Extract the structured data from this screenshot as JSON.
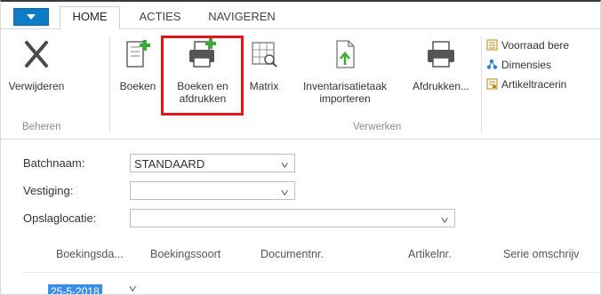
{
  "tabs": [
    {
      "label": "HOME",
      "active": true
    },
    {
      "label": "ACTIES",
      "active": false
    },
    {
      "label": "NAVIGEREN",
      "active": false
    }
  ],
  "ribbon": {
    "groups": [
      {
        "label": "Beheren"
      },
      {
        "label": "Verwerken"
      }
    ],
    "buttons": [
      {
        "label": "Verwijderen",
        "icon": "delete-x-icon"
      },
      {
        "label": "Boeken",
        "icon": "post-icon"
      },
      {
        "label": "Boeken en afdrukken",
        "icon": "post-print-icon",
        "highlighted": true
      },
      {
        "label": "Matrix",
        "icon": "matrix-icon"
      },
      {
        "label": "Inventarisatietaak importeren",
        "icon": "import-icon"
      },
      {
        "label": "Afdrukken...",
        "icon": "printer-icon"
      }
    ],
    "small_buttons": [
      {
        "label": "Voorraad bere",
        "icon": "calc-icon"
      },
      {
        "label": "Dimensies",
        "icon": "dimensions-icon"
      },
      {
        "label": "Artikeltracerin",
        "icon": "tracking-icon"
      }
    ],
    "highlight_color": "#e1131b"
  },
  "form": {
    "batch": {
      "label": "Batchnaam:",
      "value": "STANDAARD"
    },
    "location": {
      "label": "Vestiging:",
      "value": ""
    },
    "bin": {
      "label": "Opslaglocatie:",
      "value": ""
    }
  },
  "grid": {
    "columns": [
      "Boekingsda...",
      "Boekingssoort",
      "Documentnr.",
      "Artikelnr.",
      "Serie omschrijv"
    ],
    "first_row": {
      "date": "25-5-2018"
    }
  },
  "colors": {
    "accent": "#0e7bc4",
    "selection": "#3a8ee6"
  }
}
